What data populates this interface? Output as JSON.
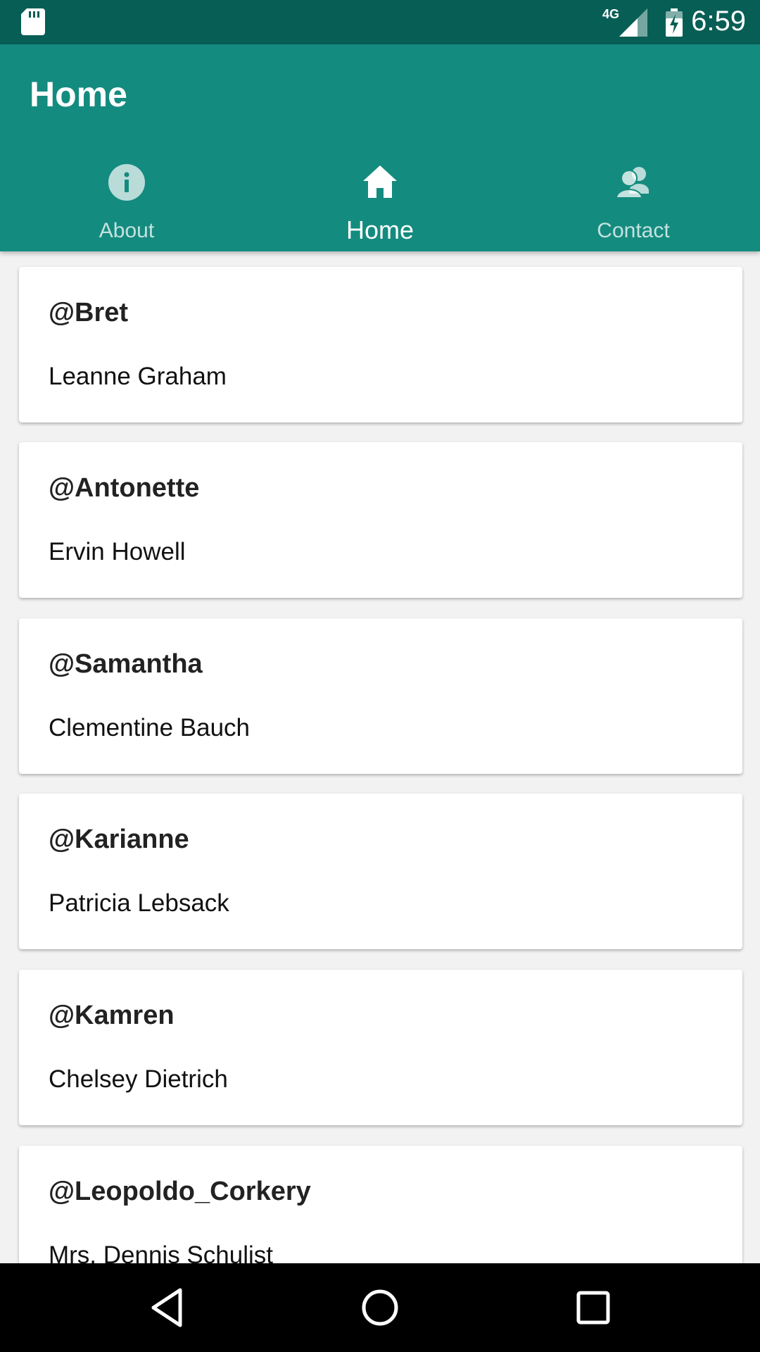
{
  "status_bar": {
    "network": "4G",
    "time": "6:59",
    "icons": [
      "sd-card-icon",
      "signal-icon",
      "battery-charging-icon"
    ]
  },
  "app_bar": {
    "title": "Home",
    "background": "#148b7f",
    "status_background": "#075e55"
  },
  "tabs": [
    {
      "label": "About",
      "icon": "info-icon",
      "active": false
    },
    {
      "label": "Home",
      "icon": "home-icon",
      "active": true
    },
    {
      "label": "Contact",
      "icon": "contacts-icon",
      "active": false
    }
  ],
  "users": [
    {
      "username": "@Bret",
      "name": "Leanne Graham"
    },
    {
      "username": "@Antonette",
      "name": "Ervin Howell"
    },
    {
      "username": "@Samantha",
      "name": "Clementine Bauch"
    },
    {
      "username": "@Karianne",
      "name": "Patricia Lebsack"
    },
    {
      "username": "@Kamren",
      "name": "Chelsey Dietrich"
    },
    {
      "username": "@Leopoldo_Corkery",
      "name": "Mrs. Dennis Schulist"
    }
  ],
  "nav_bar": {
    "buttons": [
      "back-icon",
      "home-circle-icon",
      "recents-icon"
    ]
  }
}
